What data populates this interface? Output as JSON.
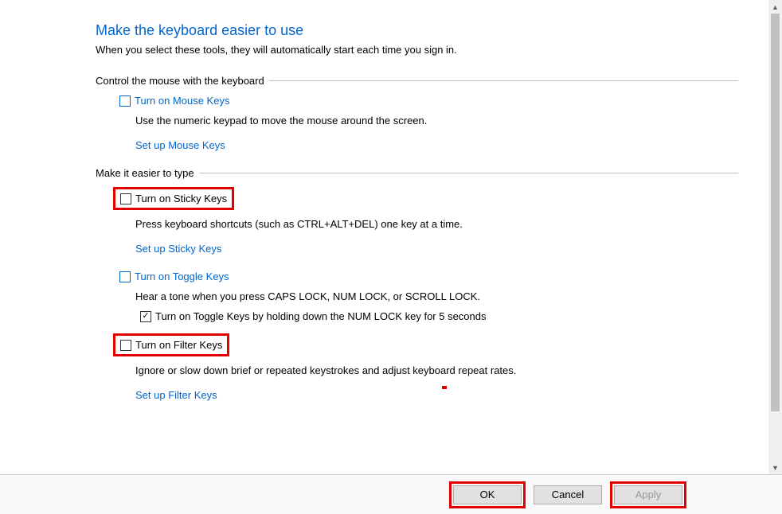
{
  "page": {
    "title": "Make the keyboard easier to use",
    "subtitle": "When you select these tools, they will automatically start each time you sign in."
  },
  "group1": {
    "legend": "Control the mouse with the keyboard",
    "option1": {
      "label": "Turn on Mouse Keys",
      "checked": false
    },
    "desc": "Use the numeric keypad to move the mouse around the screen.",
    "link": "Set up Mouse Keys"
  },
  "group2": {
    "legend": "Make it easier to type",
    "sticky": {
      "label": "Turn on Sticky Keys",
      "checked": false,
      "desc": "Press keyboard shortcuts (such as CTRL+ALT+DEL) one key at a time.",
      "link": "Set up Sticky Keys"
    },
    "toggle": {
      "label": "Turn on Toggle Keys",
      "checked": false,
      "desc": "Hear a tone when you press CAPS LOCK, NUM LOCK, or SCROLL LOCK.",
      "sub": {
        "label": "Turn on Toggle Keys by holding down the NUM LOCK key for 5 seconds",
        "checked": true
      }
    },
    "filter": {
      "label": "Turn on Filter Keys",
      "checked": false,
      "desc": "Ignore or slow down brief or repeated keystrokes and adjust keyboard repeat rates.",
      "link": "Set up Filter Keys"
    }
  },
  "buttons": {
    "ok": "OK",
    "cancel": "Cancel",
    "apply": "Apply"
  }
}
